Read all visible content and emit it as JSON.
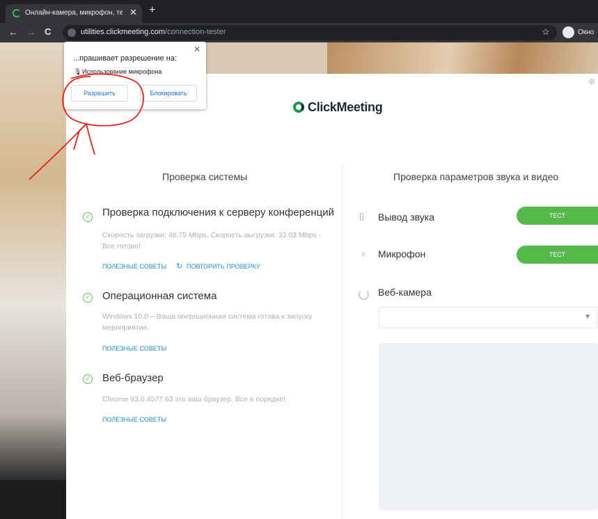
{
  "browser": {
    "tab_title": "Онлайн-камера, микрофон, тест",
    "tab_close": "✕",
    "new_tab": "+",
    "back": "←",
    "forward": "→",
    "reload": "C",
    "url_domain": "utilities.clickmeeting.com",
    "url_path": "/connection-tester",
    "bookmark": "☆",
    "profile_label": "Окно"
  },
  "permission_popup": {
    "title": "...прашивает разрешение на:",
    "permission": "Использование микрофона",
    "close": "✕",
    "allow_label": "Разрешить",
    "block_label": "Блокировать"
  },
  "page": {
    "logo_text": "ClickMeeting",
    "system_check": {
      "title": "Проверка системы",
      "items": [
        {
          "title": "Проверка подключения к серверу конференций",
          "description": "Скорость загрузки: 48.75 Mbps, Скорость выгрузки: 33.03 Mbps - Все готово!",
          "links": [
            "ПОЛЕЗНЫЕ СОВЕТЫ",
            "ПОВТОРИТЬ ПРОВЕРКУ"
          ]
        },
        {
          "title": "Операционная система",
          "description": "Windows 10.0 – Ваша операционная система готова к запуску мероприятия.",
          "links": [
            "ПОЛЕЗНЫЕ СОВЕТЫ"
          ]
        },
        {
          "title": "Веб-браузер",
          "description": "Chrome 93.0.4577.63 это ваш браузер. Все в порядке!",
          "links": [
            "ПОЛЕЗНЫЕ СОВЕТЫ"
          ]
        }
      ]
    },
    "av_check": {
      "title": "Проверка параметров звука и видео",
      "devices": [
        {
          "label": "Вывод звука",
          "button": "ТЕСТ"
        },
        {
          "label": "Микрофон",
          "button": "ТЕСТ"
        },
        {
          "label": "Веб-камера"
        }
      ],
      "camera_select_value": ""
    }
  },
  "colors": {
    "accent_green": "#54b948",
    "link_blue": "#1f8fd1",
    "annotation_red": "#e8231c"
  }
}
